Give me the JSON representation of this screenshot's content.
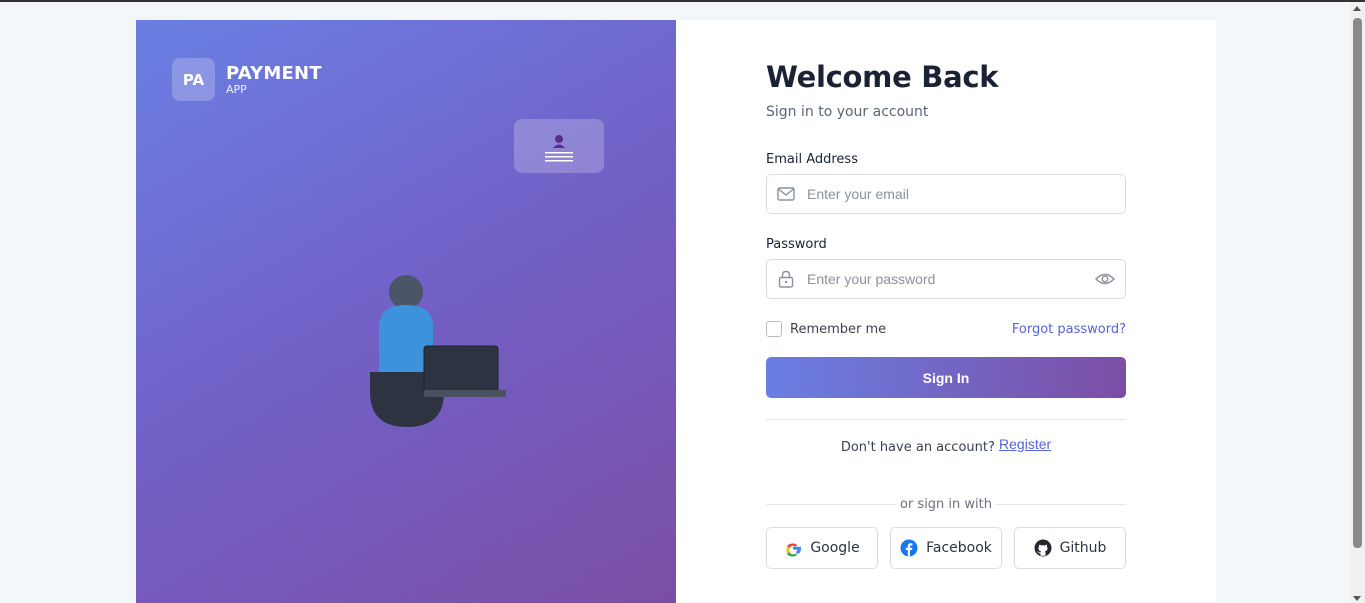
{
  "brand": {
    "badge": "PA",
    "name": "PAYMENT",
    "sub": "APP"
  },
  "form": {
    "title": "Welcome Back",
    "subtitle": "Sign in to your account",
    "email_label": "Email Address",
    "email_placeholder": "Enter your email",
    "password_label": "Password",
    "password_placeholder": "Enter your password",
    "remember_label": "Remember me",
    "remember_checked": false,
    "forgot_label": "Forgot password?",
    "signin_label": "Sign In",
    "no_account_text": "Don't have an account?",
    "register_label": "Register",
    "or_text": "or sign in with"
  },
  "social": [
    {
      "label": "Google",
      "icon": "google-icon"
    },
    {
      "label": "Facebook",
      "icon": "facebook-icon"
    },
    {
      "label": "Github",
      "icon": "github-icon"
    }
  ],
  "colors": {
    "gradient_start": "#6a7fe3",
    "gradient_end": "#7b4ea5",
    "link": "#5564d8",
    "title": "#1a2233"
  }
}
